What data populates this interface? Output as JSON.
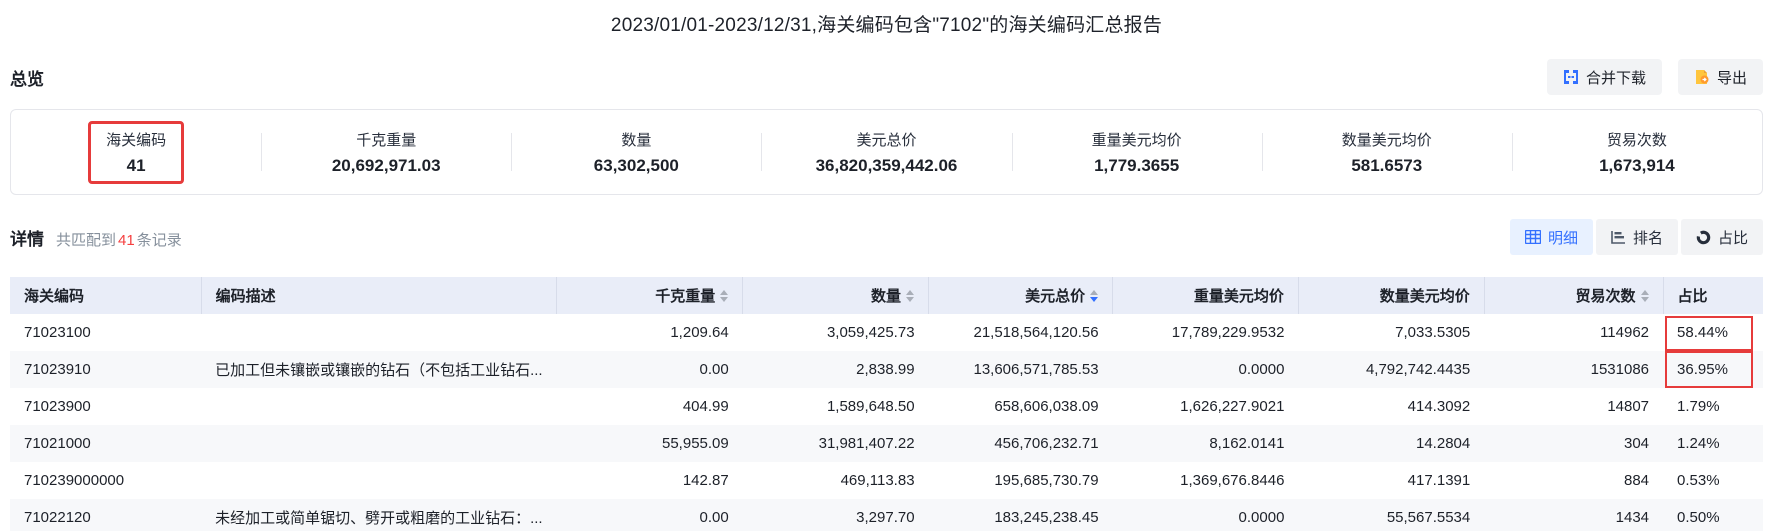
{
  "title": "2023/01/01-2023/12/31,海关编码包含\"7102\"的海关编码汇总报告",
  "colors": {
    "accent_blue": "#3370ff",
    "annotation_red": "#e63b3b",
    "count_red": "#f53f3f",
    "export_orange": "#ffa53d",
    "table_header_bg": "#e9edf8",
    "row_alt_bg": "#f7f8fa",
    "muted_text": "#86909c"
  },
  "overview": {
    "heading": "总览",
    "merge_download_label": "合并下载",
    "export_label": "导出",
    "stats": [
      {
        "label": "海关编码",
        "value": "41",
        "highlighted": true
      },
      {
        "label": "千克重量",
        "value": "20,692,971.03",
        "highlighted": false
      },
      {
        "label": "数量",
        "value": "63,302,500",
        "highlighted": false
      },
      {
        "label": "美元总价",
        "value": "36,820,359,442.06",
        "highlighted": false
      },
      {
        "label": "重量美元均价",
        "value": "1,779.3655",
        "highlighted": false
      },
      {
        "label": "数量美元均价",
        "value": "581.6573",
        "highlighted": false
      },
      {
        "label": "贸易次数",
        "value": "1,673,914",
        "highlighted": false
      }
    ]
  },
  "detail": {
    "heading": "详情",
    "match_prefix": "共匹配到",
    "match_count": "41",
    "match_suffix": "条记录",
    "view_tabs": [
      {
        "label": "明细",
        "icon": "table-icon",
        "active": true
      },
      {
        "label": "排名",
        "icon": "ranking-icon",
        "active": false
      },
      {
        "label": "占比",
        "icon": "donut-icon",
        "active": false
      }
    ]
  },
  "table": {
    "columns": [
      {
        "key": "code",
        "label": "海关编码",
        "align": "left",
        "width": "10.9%",
        "sortable": false,
        "sort": null
      },
      {
        "key": "desc",
        "label": "编码描述",
        "align": "left",
        "width": "20.3%",
        "sortable": false,
        "sort": null
      },
      {
        "key": "kg",
        "label": "千克重量",
        "align": "right",
        "width": "10.6%",
        "sortable": true,
        "sort": null
      },
      {
        "key": "qty",
        "label": "数量",
        "align": "right",
        "width": "10.6%",
        "sortable": true,
        "sort": null
      },
      {
        "key": "usd",
        "label": "美元总价",
        "align": "right",
        "width": "10.5%",
        "sortable": true,
        "sort": "desc"
      },
      {
        "key": "usd_per_kg",
        "label": "重量美元均价",
        "align": "right",
        "width": "10.6%",
        "sortable": false,
        "sort": null
      },
      {
        "key": "usd_per_qty",
        "label": "数量美元均价",
        "align": "right",
        "width": "10.6%",
        "sortable": false,
        "sort": null
      },
      {
        "key": "trades",
        "label": "贸易次数",
        "align": "right",
        "width": "10.2%",
        "sortable": true,
        "sort": null
      },
      {
        "key": "share",
        "label": "占比",
        "align": "left",
        "width": "5.7%",
        "sortable": false,
        "sort": null
      }
    ],
    "rows": [
      {
        "code": "71023100",
        "desc": "",
        "kg": "1,209.64",
        "qty": "3,059,425.73",
        "usd": "21,518,564,120.56",
        "usd_per_kg": "17,789,229.9532",
        "usd_per_qty": "7,033.5305",
        "trades": "114962",
        "share": "58.44%",
        "share_boxed": true
      },
      {
        "code": "71023910",
        "desc": "已加工但未镶嵌或镶嵌的钻石（不包括工业钻石...",
        "kg": "0.00",
        "qty": "2,838.99",
        "usd": "13,606,571,785.53",
        "usd_per_kg": "0.0000",
        "usd_per_qty": "4,792,742.4435",
        "trades": "1531086",
        "share": "36.95%",
        "share_boxed": true
      },
      {
        "code": "71023900",
        "desc": "",
        "kg": "404.99",
        "qty": "1,589,648.50",
        "usd": "658,606,038.09",
        "usd_per_kg": "1,626,227.9021",
        "usd_per_qty": "414.3092",
        "trades": "14807",
        "share": "1.79%",
        "share_boxed": false
      },
      {
        "code": "71021000",
        "desc": "",
        "kg": "55,955.09",
        "qty": "31,981,407.22",
        "usd": "456,706,232.71",
        "usd_per_kg": "8,162.0141",
        "usd_per_qty": "14.2804",
        "trades": "304",
        "share": "1.24%",
        "share_boxed": false
      },
      {
        "code": "710239000000",
        "desc": "",
        "kg": "142.87",
        "qty": "469,113.83",
        "usd": "195,685,730.79",
        "usd_per_kg": "1,369,676.8446",
        "usd_per_qty": "417.1391",
        "trades": "884",
        "share": "0.53%",
        "share_boxed": false
      },
      {
        "code": "71022120",
        "desc": "未经加工或简单锯切、劈开或粗磨的工业钻石：...",
        "kg": "0.00",
        "qty": "3,297.70",
        "usd": "183,245,238.45",
        "usd_per_kg": "0.0000",
        "usd_per_qty": "55,567.5534",
        "trades": "1434",
        "share": "0.50%",
        "share_boxed": false
      }
    ]
  }
}
